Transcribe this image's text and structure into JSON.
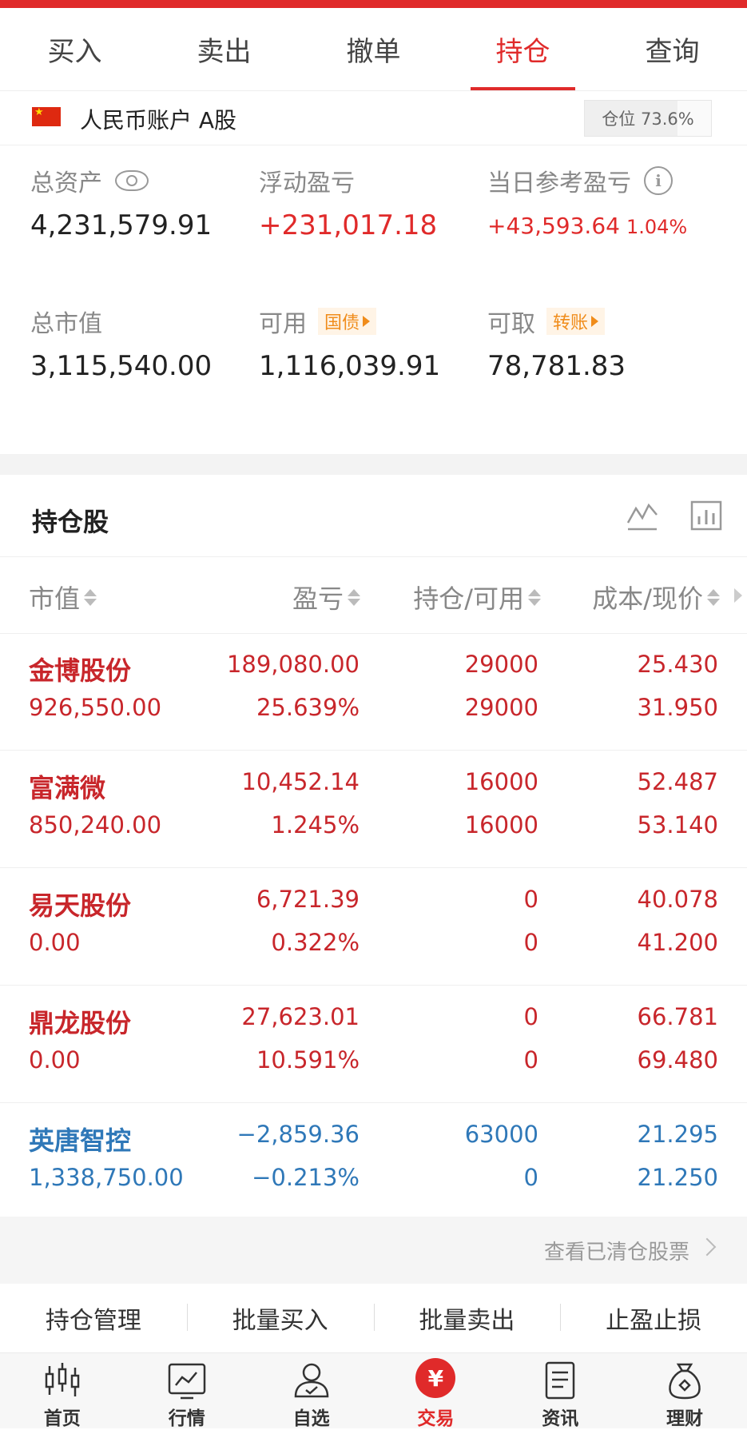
{
  "colors": {
    "accent": "#e02a2a",
    "profit": "#c8262b",
    "loss": "#2f78b8",
    "tag": "#f08c1a"
  },
  "tabs": [
    {
      "label": "买入",
      "active": false
    },
    {
      "label": "卖出",
      "active": false
    },
    {
      "label": "撤单",
      "active": false
    },
    {
      "label": "持仓",
      "active": true
    },
    {
      "label": "查询",
      "active": false
    }
  ],
  "account": {
    "name": "人民币账户 A股",
    "position_label": "仓位 73.6%",
    "position_ratio": 0.736,
    "flag_icon": "china-flag-icon"
  },
  "summary": {
    "total_assets": {
      "label": "总资产",
      "value": "4,231,579.91"
    },
    "floating_pl": {
      "label": "浮动盈亏",
      "value": "+231,017.18"
    },
    "daily_pl": {
      "label": "当日参考盈亏",
      "value": "+43,593.64",
      "pct": "1.04%"
    },
    "market_value": {
      "label": "总市值",
      "value": "3,115,540.00"
    },
    "available": {
      "label": "可用",
      "tag": "国债",
      "value": "1,116,039.91"
    },
    "withdrawable": {
      "label": "可取",
      "tag": "转账",
      "value": "78,781.83"
    }
  },
  "holdings": {
    "title": "持仓股",
    "columns": [
      "市值",
      "盈亏",
      "持仓/可用",
      "成本/现价"
    ],
    "rows": [
      {
        "name": "金博股份",
        "market_value": "926,550.00",
        "pl": "189,080.00",
        "pl_pct": "25.639%",
        "position": "29000",
        "available": "29000",
        "cost": "25.430",
        "price": "31.950",
        "trend": "up"
      },
      {
        "name": "富满微",
        "market_value": "850,240.00",
        "pl": "10,452.14",
        "pl_pct": "1.245%",
        "position": "16000",
        "available": "16000",
        "cost": "52.487",
        "price": "53.140",
        "trend": "up"
      },
      {
        "name": "易天股份",
        "market_value": "0.00",
        "pl": "6,721.39",
        "pl_pct": "0.322%",
        "position": "0",
        "available": "0",
        "cost": "40.078",
        "price": "41.200",
        "trend": "up"
      },
      {
        "name": "鼎龙股份",
        "market_value": "0.00",
        "pl": "27,623.01",
        "pl_pct": "10.591%",
        "position": "0",
        "available": "0",
        "cost": "66.781",
        "price": "69.480",
        "trend": "up"
      },
      {
        "name": "英唐智控",
        "market_value": "1,338,750.00",
        "pl": "−2,859.36",
        "pl_pct": "−0.213%",
        "position": "63000",
        "available": "0",
        "cost": "21.295",
        "price": "21.250",
        "trend": "down"
      }
    ]
  },
  "cleared_link": "查看已清仓股票",
  "actions": [
    "持仓管理",
    "批量买入",
    "批量卖出",
    "止盈止损"
  ],
  "nav": [
    {
      "label": "首页",
      "icon": "candlestick-icon",
      "active": false
    },
    {
      "label": "行情",
      "icon": "market-chart-icon",
      "active": false
    },
    {
      "label": "自选",
      "icon": "person-check-icon",
      "active": false
    },
    {
      "label": "交易",
      "icon": "yen-icon",
      "symbol": "¥",
      "active": true
    },
    {
      "label": "资讯",
      "icon": "document-icon",
      "active": false
    },
    {
      "label": "理财",
      "icon": "money-bag-icon",
      "active": false
    }
  ]
}
